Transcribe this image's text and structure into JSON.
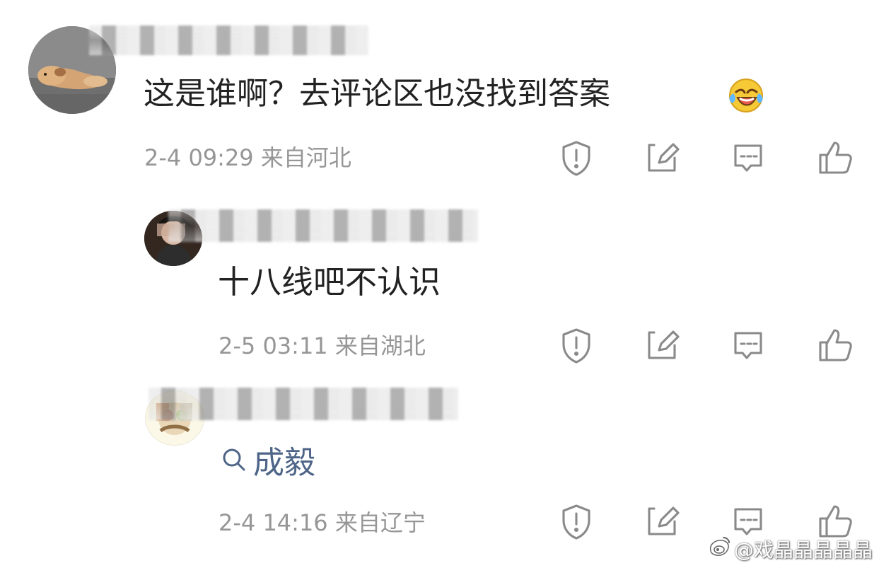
{
  "comments": [
    {
      "text": "这是谁啊？去评论区也没找到答案",
      "emoji": "laughing-crying-emoji",
      "time": "2-4 09:29",
      "location": "来自河北"
    },
    {
      "text": "十八线吧不认识",
      "time": "2-5 03:11",
      "location": "来自湖北"
    },
    {
      "search_text": "成毅",
      "time": "2-4 14:16",
      "location": "来自辽宁"
    }
  ],
  "actions": {
    "report": "shield-exclamation-icon",
    "repost": "edit-share-icon",
    "reply": "message-icon",
    "like": "thumbs-up-icon"
  },
  "watermark": {
    "text": "@戏晶晶晶晶晶",
    "icon": "weibo-icon"
  },
  "colors": {
    "primary_text": "#222222",
    "meta_text": "#969696",
    "icon_gray": "#8a8a8a",
    "link_blue": "#4f6588",
    "background": "#ffffff"
  }
}
